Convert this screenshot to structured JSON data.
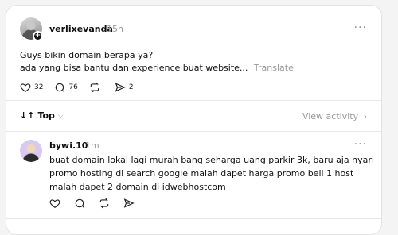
{
  "post": {
    "username": "verlixevanda",
    "time": "15h",
    "line1": "Guys bikin domain berapa ya?",
    "line2": "ada yang bisa bantu dan experience buat website...",
    "translate": "Translate",
    "likes": "32",
    "replies": "76",
    "shares": "2"
  },
  "sort": {
    "label": "Top",
    "view_activity": "View activity"
  },
  "reply": {
    "username": "bywi.10",
    "time": "1m",
    "text": "buat domain lokal lagi murah bang seharga uang parkir 3k, baru aja nyari promo hosting di search google malah dapet harga promo beli 1 host malah dapet 2 domain di idwebhostcom"
  }
}
